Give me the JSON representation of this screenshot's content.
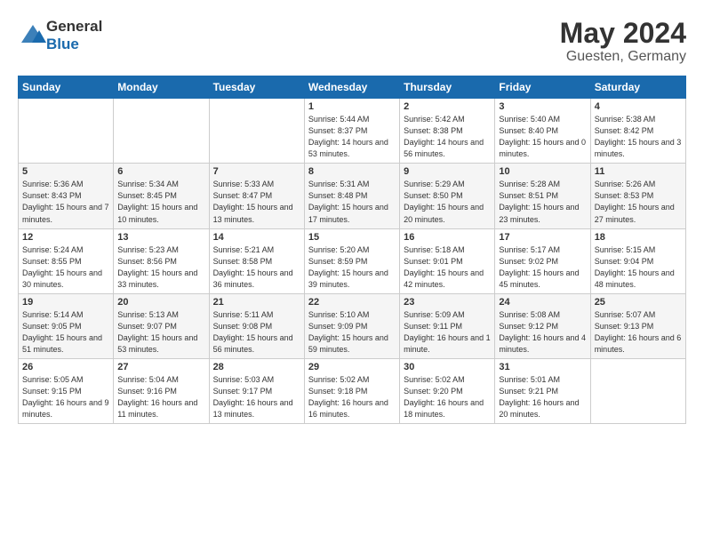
{
  "logo": {
    "text_general": "General",
    "text_blue": "Blue"
  },
  "title": {
    "month": "May 2024",
    "location": "Guesten, Germany"
  },
  "days_of_week": [
    "Sunday",
    "Monday",
    "Tuesday",
    "Wednesday",
    "Thursday",
    "Friday",
    "Saturday"
  ],
  "weeks": [
    [
      {
        "day": "",
        "info": ""
      },
      {
        "day": "",
        "info": ""
      },
      {
        "day": "",
        "info": ""
      },
      {
        "day": "1",
        "info": "Sunrise: 5:44 AM\nSunset: 8:37 PM\nDaylight: 14 hours and 53 minutes."
      },
      {
        "day": "2",
        "info": "Sunrise: 5:42 AM\nSunset: 8:38 PM\nDaylight: 14 hours and 56 minutes."
      },
      {
        "day": "3",
        "info": "Sunrise: 5:40 AM\nSunset: 8:40 PM\nDaylight: 15 hours and 0 minutes."
      },
      {
        "day": "4",
        "info": "Sunrise: 5:38 AM\nSunset: 8:42 PM\nDaylight: 15 hours and 3 minutes."
      }
    ],
    [
      {
        "day": "5",
        "info": "Sunrise: 5:36 AM\nSunset: 8:43 PM\nDaylight: 15 hours and 7 minutes."
      },
      {
        "day": "6",
        "info": "Sunrise: 5:34 AM\nSunset: 8:45 PM\nDaylight: 15 hours and 10 minutes."
      },
      {
        "day": "7",
        "info": "Sunrise: 5:33 AM\nSunset: 8:47 PM\nDaylight: 15 hours and 13 minutes."
      },
      {
        "day": "8",
        "info": "Sunrise: 5:31 AM\nSunset: 8:48 PM\nDaylight: 15 hours and 17 minutes."
      },
      {
        "day": "9",
        "info": "Sunrise: 5:29 AM\nSunset: 8:50 PM\nDaylight: 15 hours and 20 minutes."
      },
      {
        "day": "10",
        "info": "Sunrise: 5:28 AM\nSunset: 8:51 PM\nDaylight: 15 hours and 23 minutes."
      },
      {
        "day": "11",
        "info": "Sunrise: 5:26 AM\nSunset: 8:53 PM\nDaylight: 15 hours and 27 minutes."
      }
    ],
    [
      {
        "day": "12",
        "info": "Sunrise: 5:24 AM\nSunset: 8:55 PM\nDaylight: 15 hours and 30 minutes."
      },
      {
        "day": "13",
        "info": "Sunrise: 5:23 AM\nSunset: 8:56 PM\nDaylight: 15 hours and 33 minutes."
      },
      {
        "day": "14",
        "info": "Sunrise: 5:21 AM\nSunset: 8:58 PM\nDaylight: 15 hours and 36 minutes."
      },
      {
        "day": "15",
        "info": "Sunrise: 5:20 AM\nSunset: 8:59 PM\nDaylight: 15 hours and 39 minutes."
      },
      {
        "day": "16",
        "info": "Sunrise: 5:18 AM\nSunset: 9:01 PM\nDaylight: 15 hours and 42 minutes."
      },
      {
        "day": "17",
        "info": "Sunrise: 5:17 AM\nSunset: 9:02 PM\nDaylight: 15 hours and 45 minutes."
      },
      {
        "day": "18",
        "info": "Sunrise: 5:15 AM\nSunset: 9:04 PM\nDaylight: 15 hours and 48 minutes."
      }
    ],
    [
      {
        "day": "19",
        "info": "Sunrise: 5:14 AM\nSunset: 9:05 PM\nDaylight: 15 hours and 51 minutes."
      },
      {
        "day": "20",
        "info": "Sunrise: 5:13 AM\nSunset: 9:07 PM\nDaylight: 15 hours and 53 minutes."
      },
      {
        "day": "21",
        "info": "Sunrise: 5:11 AM\nSunset: 9:08 PM\nDaylight: 15 hours and 56 minutes."
      },
      {
        "day": "22",
        "info": "Sunrise: 5:10 AM\nSunset: 9:09 PM\nDaylight: 15 hours and 59 minutes."
      },
      {
        "day": "23",
        "info": "Sunrise: 5:09 AM\nSunset: 9:11 PM\nDaylight: 16 hours and 1 minute."
      },
      {
        "day": "24",
        "info": "Sunrise: 5:08 AM\nSunset: 9:12 PM\nDaylight: 16 hours and 4 minutes."
      },
      {
        "day": "25",
        "info": "Sunrise: 5:07 AM\nSunset: 9:13 PM\nDaylight: 16 hours and 6 minutes."
      }
    ],
    [
      {
        "day": "26",
        "info": "Sunrise: 5:05 AM\nSunset: 9:15 PM\nDaylight: 16 hours and 9 minutes."
      },
      {
        "day": "27",
        "info": "Sunrise: 5:04 AM\nSunset: 9:16 PM\nDaylight: 16 hours and 11 minutes."
      },
      {
        "day": "28",
        "info": "Sunrise: 5:03 AM\nSunset: 9:17 PM\nDaylight: 16 hours and 13 minutes."
      },
      {
        "day": "29",
        "info": "Sunrise: 5:02 AM\nSunset: 9:18 PM\nDaylight: 16 hours and 16 minutes."
      },
      {
        "day": "30",
        "info": "Sunrise: 5:02 AM\nSunset: 9:20 PM\nDaylight: 16 hours and 18 minutes."
      },
      {
        "day": "31",
        "info": "Sunrise: 5:01 AM\nSunset: 9:21 PM\nDaylight: 16 hours and 20 minutes."
      },
      {
        "day": "",
        "info": ""
      }
    ]
  ]
}
